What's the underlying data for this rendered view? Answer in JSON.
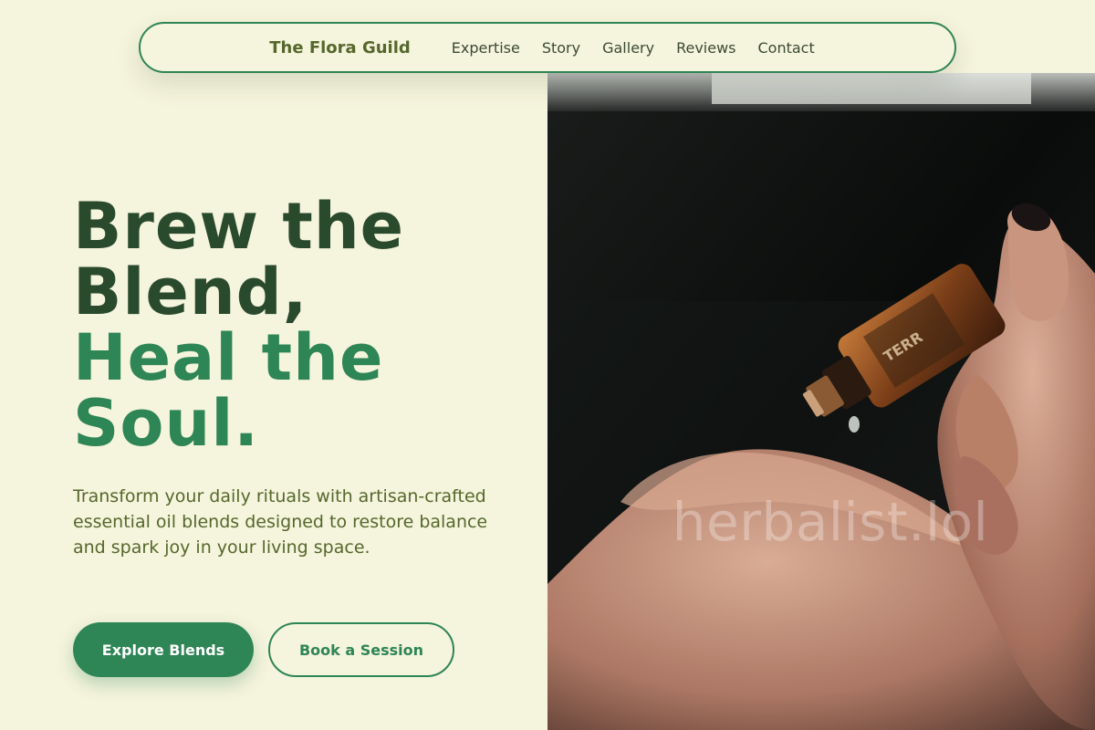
{
  "nav": {
    "brand": "The Flora Guild",
    "links": [
      "Expertise",
      "Story",
      "Gallery",
      "Reviews",
      "Contact"
    ]
  },
  "hero": {
    "headline_line1": "Brew the",
    "headline_line2": "Blend,",
    "headline_line3": "Heal the",
    "headline_line4": "Soul.",
    "subtext": "Transform your daily rituals with artisan-crafted essential oil blends designed to restore balance and spark joy in your living space.",
    "primary_cta": "Explore Blends",
    "secondary_cta": "Book a Session",
    "image_watermark": "herbalist.lol"
  },
  "colors": {
    "background": "#f5f4dc",
    "accent_green": "#2e8555",
    "dark_green": "#2a4a2e",
    "olive": "#55672c"
  }
}
